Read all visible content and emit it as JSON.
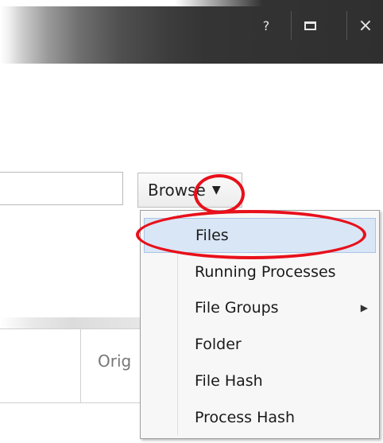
{
  "window": {
    "help_label": "?",
    "close_label": "×"
  },
  "browse": {
    "label": "Browse",
    "caret": "▼"
  },
  "background_table": {
    "partial_column_label": "Orig"
  },
  "menu": {
    "items": [
      {
        "label": "Files",
        "selected": true
      },
      {
        "label": "Running Processes"
      },
      {
        "label": "File Groups",
        "has_submenu": true
      },
      {
        "label": "Folder"
      },
      {
        "label": "File Hash"
      },
      {
        "label": "Process Hash"
      }
    ],
    "submenu_arrow": "▶"
  },
  "colors": {
    "annotation": "#e8101a",
    "selected_item": "#d9e6f5"
  }
}
